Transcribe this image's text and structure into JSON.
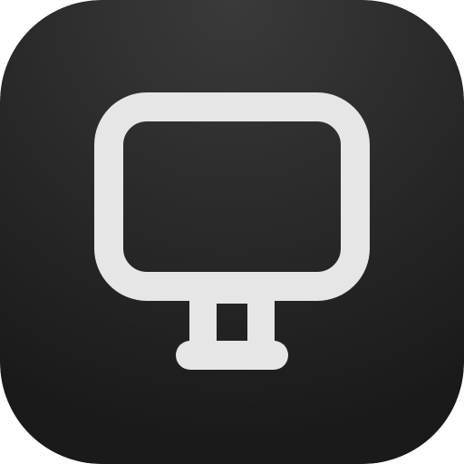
{
  "app_icon": {
    "icon": "monitor-icon",
    "colors": {
      "background_center": "#3a3a3a",
      "background_edge": "#1a1a1a",
      "glyph": "#e6e6e6"
    }
  }
}
